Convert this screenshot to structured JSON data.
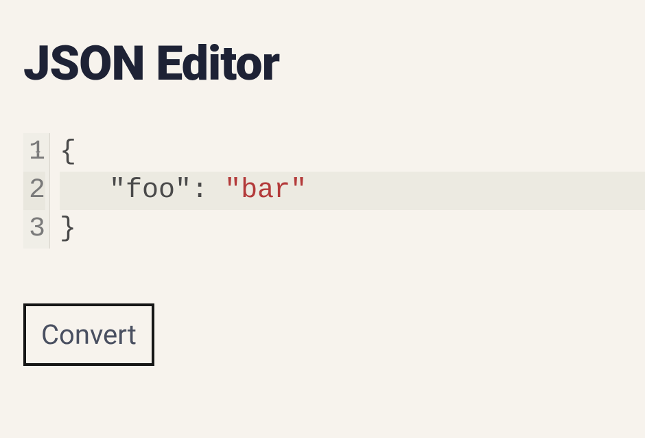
{
  "header": {
    "title": "JSON Editor"
  },
  "editor": {
    "active_line": 2,
    "lines": [
      {
        "num": "1",
        "foldable": true
      },
      {
        "num": "2",
        "foldable": false
      },
      {
        "num": "3",
        "foldable": false
      }
    ],
    "code": {
      "line1_brace": "{",
      "line2_indent": "   ",
      "line2_key": "\"foo\"",
      "line2_colon": ": ",
      "line2_value": "\"bar\"",
      "line3_brace": "}"
    }
  },
  "actions": {
    "convert_label": "Convert"
  }
}
